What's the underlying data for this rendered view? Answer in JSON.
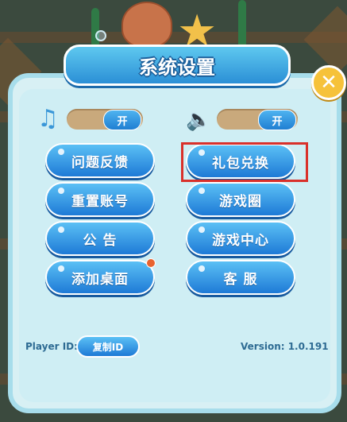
{
  "dialog": {
    "title": "系统设置",
    "close_glyph": "✕",
    "music": {
      "icon": "music-note-icon",
      "glyph": "♫",
      "toggle_label": "开"
    },
    "sound": {
      "icon": "speaker-icon",
      "glyph": "🔈",
      "toggle_label": "开"
    },
    "buttons": {
      "feedback": "问题反馈",
      "gift_redeem": "礼包兑换",
      "reset_account": "重置账号",
      "game_circle": "游戏圈",
      "notice": "公 告",
      "game_center": "游戏中心",
      "add_desktop": "添加桌面",
      "customer_service": "客 服"
    },
    "footer": {
      "player_id_label": "Player ID:",
      "copy_id_label": "复制ID",
      "version": "Version: 1.0.191"
    }
  },
  "colors": {
    "primary_button": "#1e7ad6",
    "panel": "#d8f0f4",
    "highlight_box": "#d9302a",
    "close_button": "#f6c23a",
    "notification_dot": "#e8632f"
  }
}
